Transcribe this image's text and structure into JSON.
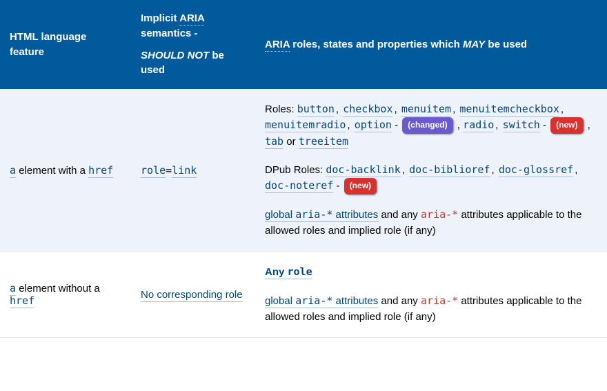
{
  "header": {
    "col1": "HTML language feature",
    "col2_line1_prefix": "Implicit ",
    "col2_line1_abbr": "ARIA",
    "col2_line1_suffix": " semantics -",
    "col2_line2_em": "SHOULD NOT",
    "col2_line2_suffix": " be used",
    "col3_abbr": "ARIA",
    "col3_mid": " roles, states and properties which ",
    "col3_em": "MAY",
    "col3_suffix": " be used"
  },
  "row1": {
    "feature_link1": "a",
    "feature_mid": " element with a ",
    "feature_link2": "href",
    "implicit_role": "role",
    "implicit_eq": "=",
    "implicit_val": "link",
    "roles_label": "Roles: ",
    "roles_list": [
      "button",
      "checkbox",
      "menuitem",
      "menuitemcheckbox",
      "menuitemradio",
      "option"
    ],
    "roles_after_option_dash": " - ",
    "badge_changed": "(changed)",
    "roles_tail1": [
      "radio",
      "switch"
    ],
    "roles_tail_dash": " - ",
    "badge_new1": "(new)",
    "roles_tail_sep": " , ",
    "roles_tab": "tab",
    "roles_or": " or ",
    "roles_treeitem": "treeitem",
    "dpub_label": "DPub Roles: ",
    "dpub_list": [
      "doc-backlink",
      "doc-biblioref",
      "doc-glossref",
      "doc-noteref"
    ],
    "dpub_dash": " - ",
    "badge_new2": "(new)",
    "global_link": "global ",
    "global_code": "aria-*",
    "global_link_suffix": " attributes",
    "global_mid": " and any ",
    "any_code": "aria-*",
    "global_tail": " attributes applicable to the allowed roles and implied role (if any)"
  },
  "row2": {
    "feature_link1": "a",
    "feature_mid": " element without a ",
    "feature_link2": "href",
    "implicit_link": "No corresponding role",
    "any_label": "Any",
    "any_role": "role",
    "global_link": "global ",
    "global_code": "aria-*",
    "global_link_suffix": " attributes",
    "global_mid": " and any ",
    "any_code": "aria-*",
    "global_tail": " attributes applicable to the allowed roles and implied role (if any)"
  },
  "punct": {
    "comma": ", ",
    "comma_trail": " ,"
  }
}
